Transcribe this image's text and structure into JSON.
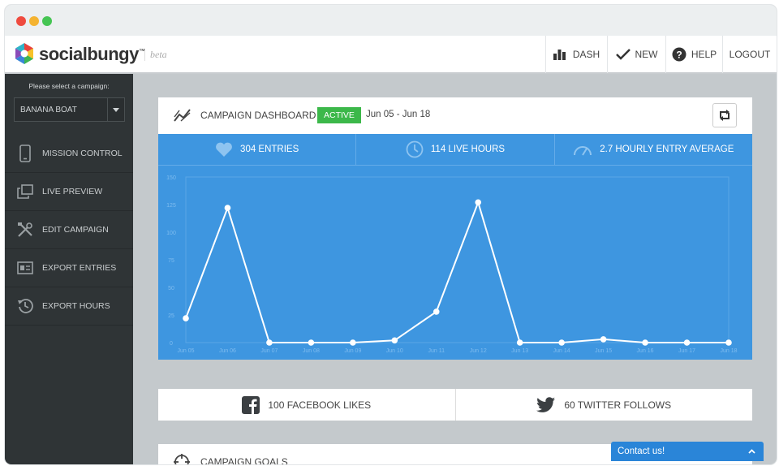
{
  "window": {
    "traffic_lights": [
      {
        "name": "close",
        "color": "#ef4b3f"
      },
      {
        "name": "minimize",
        "color": "#f4b331"
      },
      {
        "name": "maximize",
        "color": "#45c553"
      }
    ]
  },
  "brand": {
    "name": "socialbungy",
    "trademark": "™",
    "tag": "beta",
    "logo_colors": [
      "#e9423b",
      "#f7c228",
      "#3eb553",
      "#3a86d8",
      "#8a4bb8"
    ]
  },
  "topnav": {
    "items": [
      {
        "label": "DASH",
        "icon": "bar-chart-icon"
      },
      {
        "label": "NEW",
        "icon": "checkmark-icon"
      },
      {
        "label": "HELP",
        "icon": "help-icon"
      },
      {
        "label": "LOGOUT"
      }
    ]
  },
  "sidebar": {
    "prompt": "Please select a campaign:",
    "selected_campaign": "BANANA BOAT",
    "items": [
      {
        "label": "MISSION CONTROL",
        "icon": "phone-icon"
      },
      {
        "label": "LIVE PREVIEW",
        "icon": "preview-icon"
      },
      {
        "label": "EDIT CAMPAIGN",
        "icon": "tools-icon"
      },
      {
        "label": "EXPORT ENTRIES",
        "icon": "id-card-icon"
      },
      {
        "label": "EXPORT HOURS",
        "icon": "history-icon"
      }
    ]
  },
  "dashboard": {
    "title": "CAMPAIGN DASHBOARD",
    "status": "ACTIVE",
    "date_range": "Jun 05 - Jun 18",
    "stats": [
      {
        "label": "304 ENTRIES",
        "icon": "heart-icon"
      },
      {
        "label": "114 LIVE HOURS",
        "icon": "clock-icon"
      },
      {
        "label": "2.7 HOURLY ENTRY AVERAGE",
        "icon": "gauge-icon"
      }
    ]
  },
  "chart_data": {
    "type": "line",
    "categories": [
      "Jun 05",
      "Jun 06",
      "Jun 07",
      "Jun 08",
      "Jun 09",
      "Jun 10",
      "Jun 11",
      "Jun 12",
      "Jun 13",
      "Jun 14",
      "Jun 15",
      "Jun 16",
      "Jun 17",
      "Jun 18"
    ],
    "values": [
      22,
      122,
      0,
      0,
      0,
      2,
      28,
      127,
      0,
      0,
      3,
      0,
      0,
      0
    ],
    "yticks": [
      0,
      25,
      50,
      75,
      100,
      125,
      150
    ],
    "ylim": [
      0,
      150
    ],
    "grid": false,
    "colors": {
      "background": "#3e96e0",
      "line": "#ffffff",
      "tick_text": "#7fbcef"
    }
  },
  "social": {
    "facebook": {
      "label": "100 FACEBOOK LIKES",
      "icon": "facebook-icon"
    },
    "twitter": {
      "label": "60 TWITTER FOLLOWS",
      "icon": "twitter-icon"
    }
  },
  "goals": {
    "title": "CAMPAIGN GOALS",
    "icon": "crosshair-icon"
  },
  "contact": {
    "label": "Contact us!"
  }
}
